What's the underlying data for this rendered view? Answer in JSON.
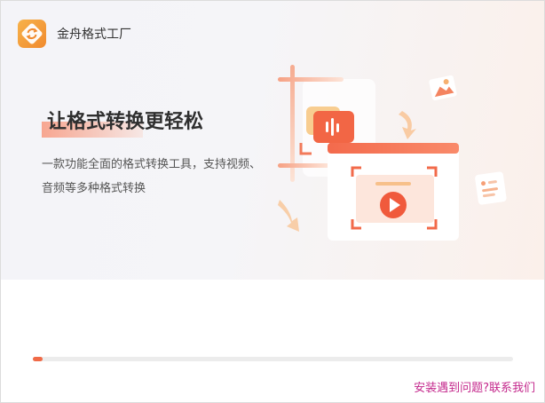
{
  "app": {
    "title": "金舟格式工厂",
    "logo_icon": "convert-arrows-icon"
  },
  "banner": {
    "headline": "让格式转换更轻松",
    "subtitle_line1": "一款功能全面的格式转换工具，支持视频、",
    "subtitle_line2": "音频等多种格式转换",
    "illustration_icons": [
      "audio-icon",
      "video-play-icon",
      "image-icon",
      "document-icon",
      "arrow-icon"
    ]
  },
  "install": {
    "progress": 0.02
  },
  "footer": {
    "help_link": "安装遇到问题?联系我们"
  },
  "colors": {
    "accent": "#f06a47",
    "link": "#c4288c",
    "logo": "#f4a03c"
  }
}
